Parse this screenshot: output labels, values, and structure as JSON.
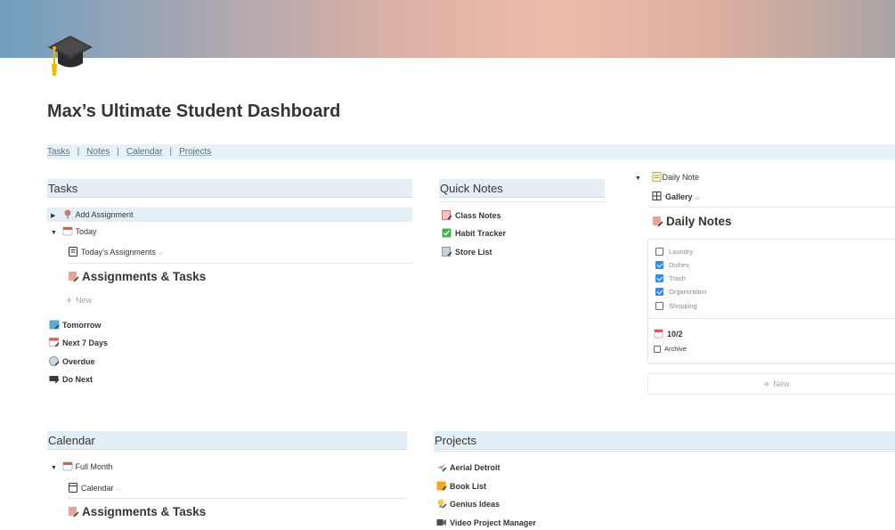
{
  "page": {
    "title": "Max’s Ultimate Student Dashboard"
  },
  "nav": [
    "Tasks",
    "Notes",
    "Calendar",
    "Projects"
  ],
  "nav_separator": "|",
  "tasks": {
    "header": "Tasks",
    "add_assignment": "Add Assignment",
    "today": "Today",
    "todays_view": "Today’s Assignments",
    "db_title": "Assignments & Tasks",
    "new_label": "New",
    "links": [
      "Tomorrow",
      "Next 7 Days",
      "Overdue",
      "Do Next"
    ]
  },
  "quick_notes": {
    "header": "Quick Notes",
    "items": [
      "Class Notes",
      "Habit Tracker",
      "Store List"
    ]
  },
  "daily": {
    "toggle": "Daily Note",
    "view": "Gallery",
    "db_title": "Daily Notes",
    "checklist": [
      {
        "label": "Laundry",
        "checked": false
      },
      {
        "label": "Dishes",
        "checked": true
      },
      {
        "label": "Trash",
        "checked": true
      },
      {
        "label": "Organization",
        "checked": true
      },
      {
        "label": "Shopping",
        "checked": false
      }
    ],
    "entry_date": "10/2",
    "archive_label": "Archive",
    "new_label": "New"
  },
  "calendar": {
    "header": "Calendar",
    "full_month": "Full Month",
    "view": "Calendar",
    "db_title": "Assignments & Tasks"
  },
  "projects": {
    "header": "Projects",
    "items": [
      "Aerial Detroit",
      "Book List",
      "Genius Ideas",
      "Video Project Manager"
    ]
  }
}
